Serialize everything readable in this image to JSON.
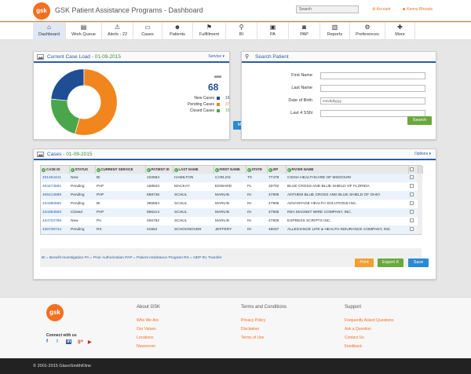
{
  "header": {
    "title": "GSK Patient Assistance Programs - Dashboard",
    "logo_text": "gsk",
    "search_placeholder": "Search",
    "account_label": "Account",
    "user_name": "Kenny Rhoads"
  },
  "nav": {
    "items": [
      {
        "label": "Dashboard",
        "icon": "⌂"
      },
      {
        "label": "Work Queue",
        "icon": "▤"
      },
      {
        "label": "Alerts - 22",
        "icon": "⚠"
      },
      {
        "label": "Cases",
        "icon": "▭"
      },
      {
        "label": "Patients",
        "icon": "☻"
      },
      {
        "label": "Fulfillment",
        "icon": "⚑"
      },
      {
        "label": "BI",
        "icon": "⚲"
      },
      {
        "label": "PA",
        "icon": "▣"
      },
      {
        "label": "PAP",
        "icon": "◙"
      },
      {
        "label": "Reports",
        "icon": "▥"
      },
      {
        "label": "Preferences",
        "icon": "⚙"
      },
      {
        "label": "More",
        "icon": "✚"
      }
    ]
  },
  "caseload": {
    "title": "Current Case Load - ",
    "date": "01-09-2015",
    "menu_label": "Service",
    "total": "68",
    "stats": [
      {
        "label": "New Cases",
        "value": "16",
        "color": "#1f4e94"
      },
      {
        "label": "Pending Cases",
        "value": "37",
        "color": "#f0861d"
      },
      {
        "label": "Closed Cases",
        "value": "15",
        "color": "#4aa64a"
      }
    ],
    "more_label": "More"
  },
  "search_patient": {
    "title": "Search Patient",
    "fields": [
      {
        "label": "First Name",
        "placeholder": ""
      },
      {
        "label": "Last Name",
        "placeholder": ""
      },
      {
        "label": "Date of Birth",
        "placeholder": "mm/dd/yyyy"
      },
      {
        "label": "Last 4 SSN",
        "placeholder": ""
      }
    ],
    "search_label": "Search"
  },
  "cases": {
    "title": "Cases - ",
    "date": "01-09-2015",
    "menu_label": "Options",
    "columns": [
      "CASE ID",
      "STATUS",
      "CURRENT SERVICE",
      "PATIENT ID",
      "LAST NAME",
      "FIRST NAME",
      "STATE",
      "ZIP",
      "PAYER NAME"
    ],
    "rows": [
      [
        "401454441",
        "New",
        "BI",
        "102584",
        "HAMILTON",
        "CARLOS",
        "TX",
        "77479",
        "CIGNA HEALTHCARE OF MISSOURI"
      ],
      [
        "404473591",
        "Pending",
        "PAP",
        "158523",
        "MACKAY",
        "EDWARD",
        "FL",
        "33702",
        "BLUE CROSS AND BLUE SHIELD OF FLORIDA"
      ],
      [
        "405412889",
        "Pending",
        "PAP",
        "658745",
        "SCHUL",
        "MARLIN",
        "IN",
        "47905",
        "ANTHEM BLUE CROSS AND BLUE SHIELD OF OHIO"
      ],
      [
        "434380650",
        "Pending",
        "BI",
        "365854",
        "SCHUL",
        "MARLIN",
        "IN",
        "47905",
        "ADVANTAGE HEALTH SOLUTIONS INC."
      ],
      [
        "434384593",
        "Closed",
        "PAP",
        "856214",
        "SCHUL",
        "MARLIN",
        "IN",
        "47905",
        "REA MAGNET WIRE COMPANY, INC."
      ],
      [
        "434722789",
        "New",
        "PA",
        "006782",
        "SCHUL",
        "MARLIN",
        "IN",
        "47905",
        "EXPRESS SCRIPTS INC."
      ],
      [
        "436738744",
        "Pending",
        "RX",
        "21654",
        "SCHOONOVER",
        "JEFFERY",
        "IN",
        "46037",
        "ALLEGIANCE LIFE & HEALTH INSURANCE COMPANY, INC."
      ]
    ],
    "legend": "BI = Benefit Investigation   PA = Prior Authorization   PAP = Patient Assistance Program   RX = NDP Rx Transfer",
    "print_label": "Print",
    "export_label": "Export X",
    "save_label": "Save"
  },
  "footer": {
    "logo_text": "gsk",
    "connect_label": "Connect with us",
    "social": [
      "f",
      "t",
      "in",
      "g+",
      "▶"
    ],
    "columns": [
      {
        "title": "About GSK",
        "links": [
          "Who We Are",
          "Our Values",
          "Locations",
          "Newsroom"
        ]
      },
      {
        "title": "Terms and Conditions",
        "links": [
          "Privacy Policy",
          "Disclaimer",
          "Terms of Use"
        ]
      },
      {
        "title": "Support",
        "links": [
          "Frequently Asked Questions",
          "Ask a Question",
          "Contact Us",
          "Feedback"
        ]
      }
    ],
    "copyright": "© 2001-2015 GlaxoSmithKline"
  },
  "colors": {
    "accent": "#f36f21",
    "primary": "#2a5ca8",
    "new": "#1f4e94",
    "pending": "#f0861d",
    "closed": "#4aa64a"
  }
}
